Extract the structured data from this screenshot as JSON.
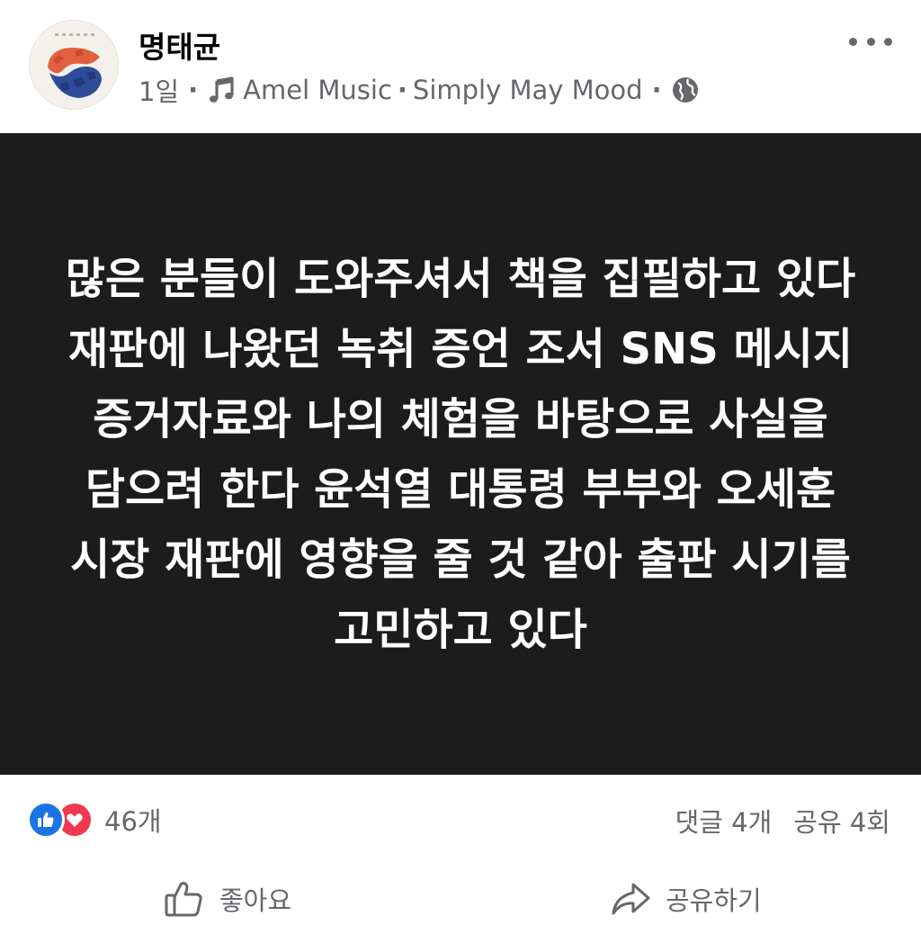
{
  "post": {
    "author": "명태균",
    "time": "1일",
    "music": "Amel Music",
    "track": "Simply May Mood",
    "audience_icon": "globe-icon",
    "text": "많은 분들이 도와주셔서 책을 집필하고 있다 재판에 나왔던 녹취 증언 조서 SNS 메시지 증거자료와 나의 체험을 바탕으로 사실을 담으려 한다 윤석열 대통령 부부와 오세훈 시장 재판에 영향을 줄 것 같아 출판 시기를 고민하고 있다"
  },
  "stats": {
    "reactions": "46개",
    "comments": "댓글 4개",
    "shares": "공유 4회"
  },
  "actions": {
    "like": "좋아요",
    "share": "공유하기"
  },
  "colors": {
    "post_background": "#1c1c1c",
    "post_text": "#ffffff",
    "like_blue": "#1b74e4",
    "love_red": "#f0384f",
    "secondary_text": "#65676b"
  },
  "icons": {
    "audience": "globe-icon",
    "music": "music-note-icon",
    "more": "more-options-icon",
    "like_action": "thumbs-up-icon",
    "share_action": "share-arrow-icon"
  }
}
